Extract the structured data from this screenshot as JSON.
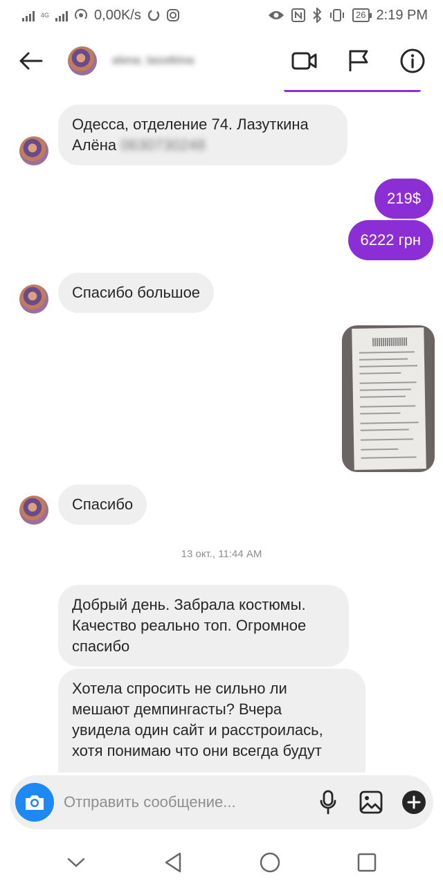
{
  "status_bar": {
    "network": "4G",
    "speed": "0,00K/s",
    "battery": "26",
    "time": "2:19 PM"
  },
  "header": {
    "username": "alena_lazutkina",
    "icons": [
      "back-arrow-icon",
      "video-call-icon",
      "flag-icon",
      "info-icon"
    ]
  },
  "messages": {
    "m1_line1": "Одесса, отделение 74. Лазуткина",
    "m1_line2_name": "Алёна",
    "m1_line2_phone": "0630730248",
    "m2": "219$",
    "m3": "6222 грн",
    "m4": "Спасибо большое",
    "m6": "Спасибо",
    "timestamp": "13 окт., 11:44 AM",
    "m7_line1": "Добрый день. Забрала костюмы.",
    "m7_line2": "Качество реально топ. Огромное",
    "m7_line3": "спасибо",
    "m8_line1": "Хотела спросить не сильно ли",
    "m8_line2": "мешают демпингасты? Вчера",
    "m8_line3": "увидела один сайт и расстроилась,",
    "m8_line4": "хотя понимаю что они всегда будут"
  },
  "composer": {
    "placeholder": "Отправить сообщение..."
  },
  "colors": {
    "accent": "#8b2ed6",
    "camera": "#1e88f5",
    "incoming_bubble": "#efefef"
  }
}
